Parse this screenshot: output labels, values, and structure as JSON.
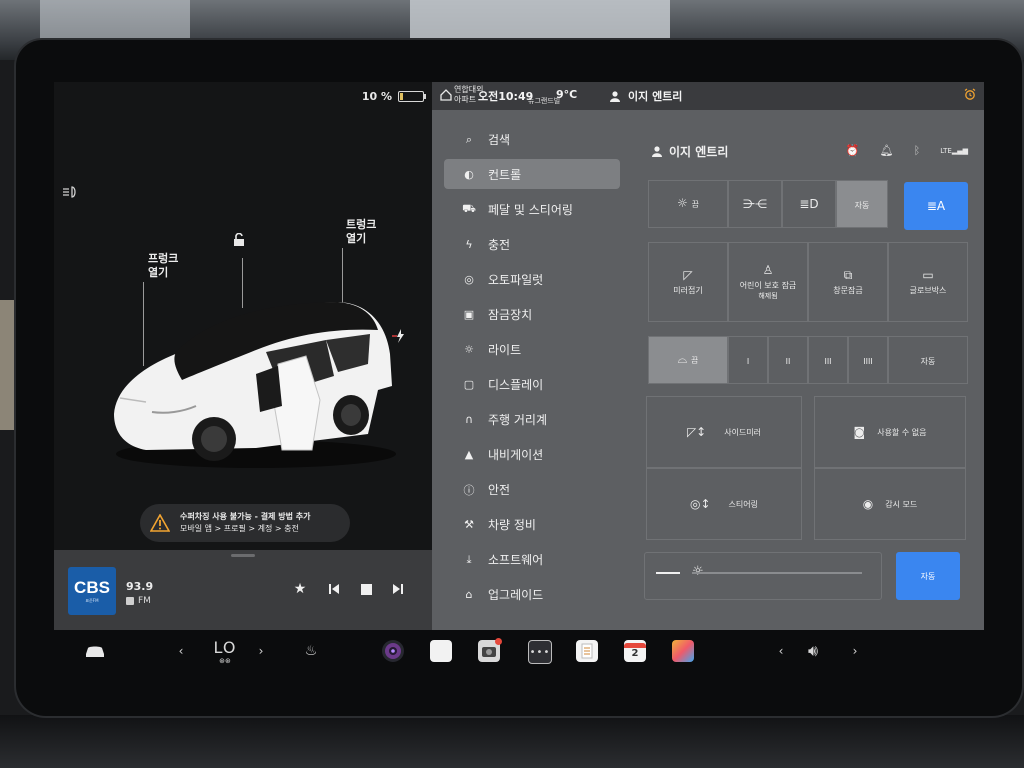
{
  "status": {
    "battery_percent": "10 %",
    "place_top": "연합대외",
    "place_bottom": "아파트",
    "time": "오전10:49",
    "place_sub": "뉴그랜드빌",
    "temp": "9°C",
    "user": "이지 엔트리"
  },
  "car": {
    "front_trunk": "프렁크\n열기",
    "trunk": "트렁크\n열기"
  },
  "alert": {
    "line1": "수퍼차징 사용 불가능 - 결제 방법 추가",
    "line2": "모바일 앱 > 프로필 > 계정 > 충전"
  },
  "media": {
    "station_logo": "CBS",
    "station_logo_sub": "표준FM",
    "frequency": "93.9",
    "band": "FM"
  },
  "menu": [
    {
      "icon": "search-icon",
      "label": "검색"
    },
    {
      "icon": "toggle-icon",
      "label": "컨트롤",
      "active": true
    },
    {
      "icon": "car-icon",
      "label": "페달 및 스티어링"
    },
    {
      "icon": "bolt-icon",
      "label": "충전"
    },
    {
      "icon": "steering-wheel-icon",
      "label": "오토파일럿"
    },
    {
      "icon": "lock-icon",
      "label": "잠금장치"
    },
    {
      "icon": "sun-icon",
      "label": "라이트"
    },
    {
      "icon": "display-icon",
      "label": "디스플레이"
    },
    {
      "icon": "odometer-icon",
      "label": "주행 거리계"
    },
    {
      "icon": "navigation-icon",
      "label": "내비게이션"
    },
    {
      "icon": "info-icon",
      "label": "안전"
    },
    {
      "icon": "wrench-icon",
      "label": "차량 정비"
    },
    {
      "icon": "download-icon",
      "label": "소프트웨어"
    },
    {
      "icon": "bag-icon",
      "label": "업그레이드"
    }
  ],
  "controls": {
    "profile_name": "이지 엔트리",
    "lights": {
      "off": "끔",
      "auto": "자동"
    },
    "row2": [
      "미러접기",
      "어린이 보호 잠금",
      "창문잠금",
      "글로브박스"
    ],
    "child_lock_sub": "해제됨",
    "wipers": {
      "off": "끔",
      "s1": "I",
      "s2": "II",
      "s3": "III",
      "s4": "IIII",
      "auto": "자동"
    },
    "side_mirror": "사이드미러",
    "unavailable": "사용할 수 없음",
    "steering": "스티어링",
    "sentry": "감시 모드",
    "brightness_auto": "자동"
  },
  "icon_colors": {
    "alarm": "#f2a431",
    "highlight": "#3a86f0"
  },
  "taskbar": {
    "climate_temp": "LO",
    "calendar_day": "2"
  }
}
